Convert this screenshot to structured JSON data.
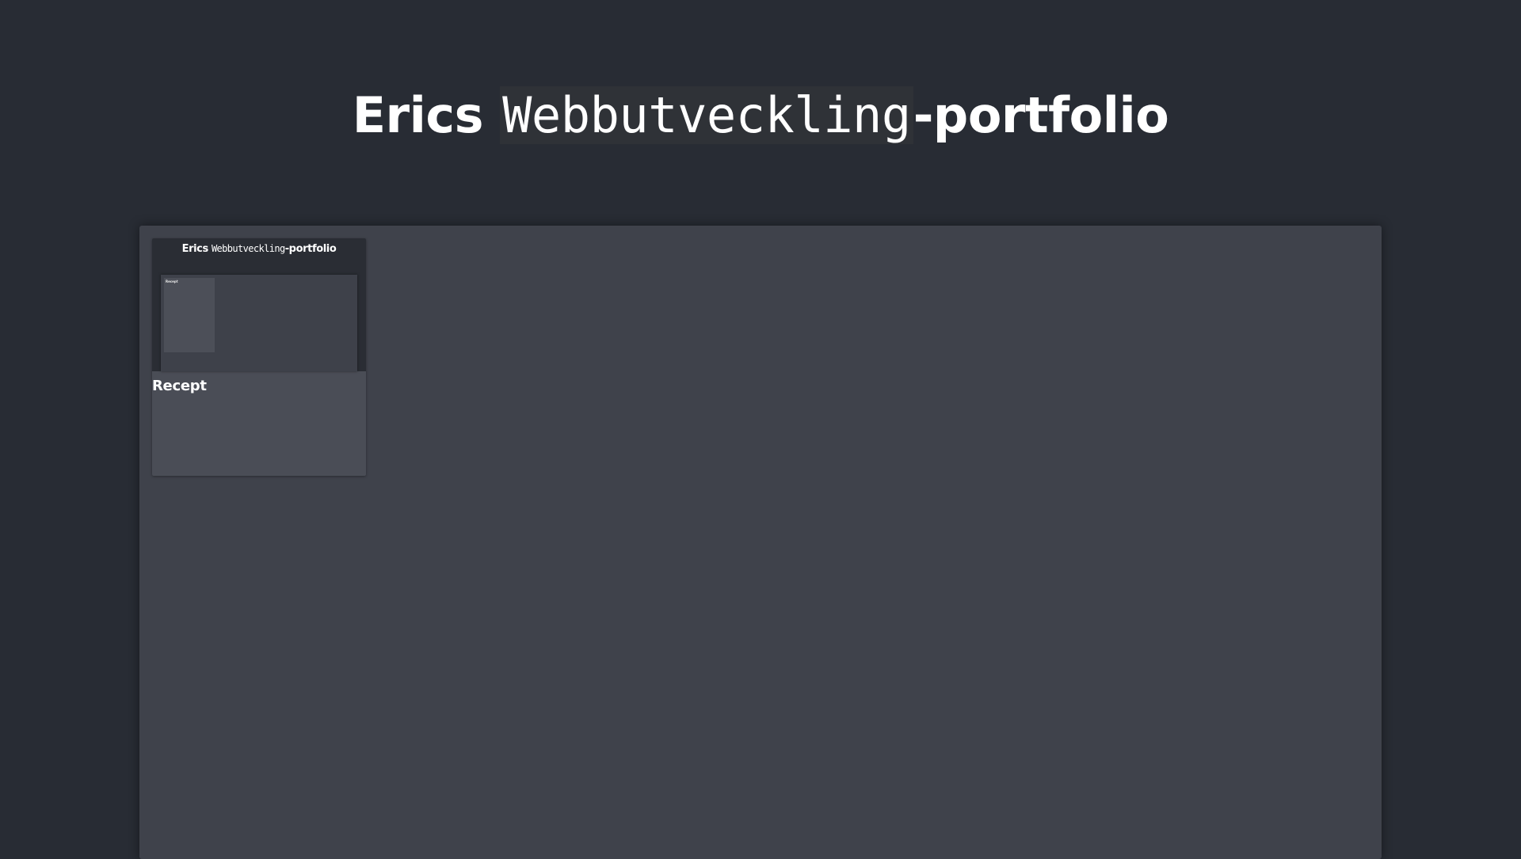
{
  "header": {
    "title_prefix": "Erics ",
    "title_code": "Webbutveckling",
    "title_suffix": "-portfolio"
  },
  "projects": [
    {
      "title": "Recept",
      "thumbnail": {
        "title_prefix": "Erics ",
        "title_code": "Webbutveckling",
        "title_suffix": "-portfolio",
        "card_label": "Recept"
      }
    }
  ]
}
